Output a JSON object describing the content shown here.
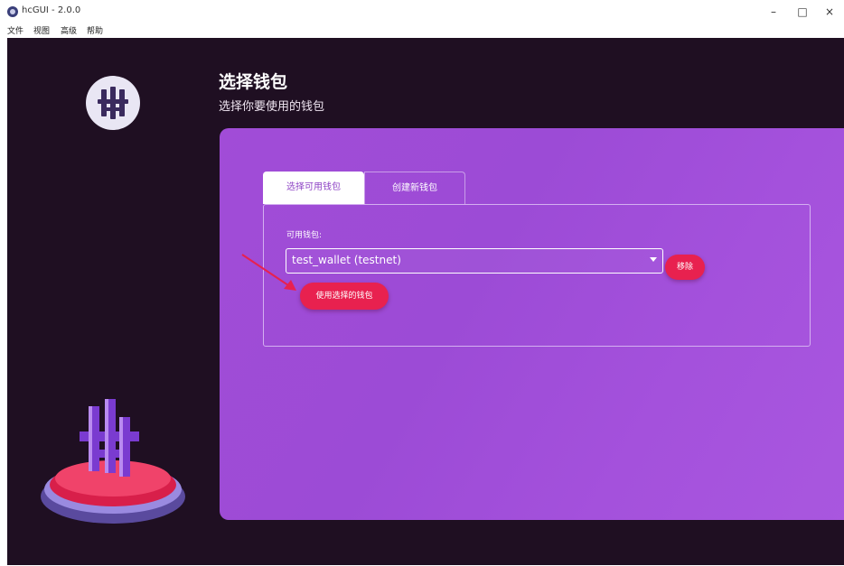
{
  "window": {
    "title": "hcGUI - 2.0.0",
    "controls": {
      "minimize": "–",
      "maximize": "□",
      "close": "×"
    }
  },
  "menubar": {
    "items": [
      "文件",
      "视图",
      "高级",
      "帮助"
    ]
  },
  "header": {
    "title": "选择钱包",
    "subtitle": "选择你要使用的钱包"
  },
  "tabs": [
    {
      "label": "选择可用钱包",
      "active": true
    },
    {
      "label": "创建新钱包",
      "active": false
    }
  ],
  "form": {
    "wallet_label": "可用钱包:",
    "selected_wallet": "test_wallet (testnet)",
    "remove_label": "移除",
    "use_label": "使用选择的钱包"
  },
  "colors": {
    "background": "#1f0f22",
    "card": "#a14cd7",
    "accent": "#e8214f"
  },
  "icons": [
    "app-logo-icon",
    "dropdown-caret-icon",
    "pointer-arrow-icon",
    "logo-pedestal-illustration"
  ]
}
